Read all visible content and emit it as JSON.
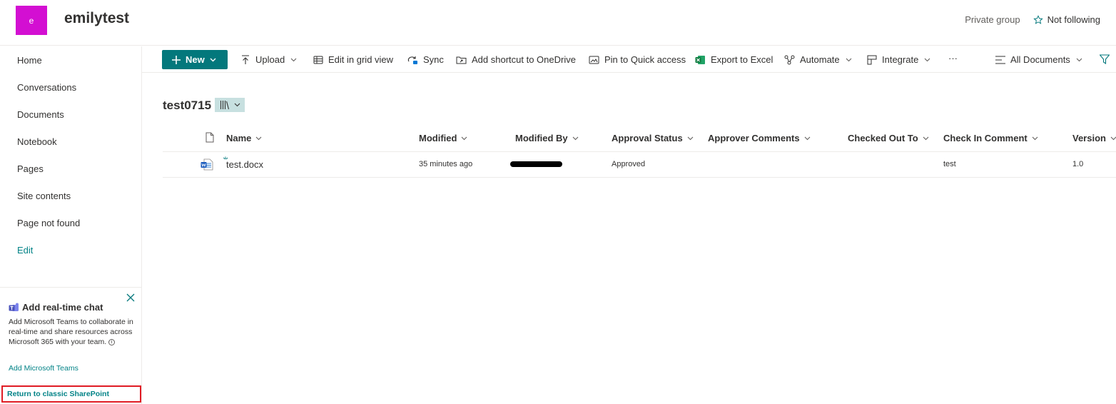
{
  "site": {
    "logo_letter": "e",
    "logo_color": "#d30fd2",
    "title": "emilytest",
    "privacy": "Private group",
    "follow_label": "Not following"
  },
  "nav": {
    "items": [
      {
        "label": "Home"
      },
      {
        "label": "Conversations"
      },
      {
        "label": "Documents"
      },
      {
        "label": "Notebook"
      },
      {
        "label": "Pages"
      },
      {
        "label": "Site contents"
      },
      {
        "label": "Page not found"
      }
    ],
    "edit_label": "Edit"
  },
  "teams_card": {
    "title": "Add real-time chat",
    "description": "Add Microsoft Teams to collaborate in real-time and share resources across Microsoft 365 with your team.",
    "link": "Add Microsoft Teams",
    "info_glyph": "i"
  },
  "classic_link": "Return to classic SharePoint",
  "command_bar": {
    "new_label": "New",
    "upload_label": "Upload",
    "grid_label": "Edit in grid view",
    "sync_label": "Sync",
    "shortcut_label": "Add shortcut to OneDrive",
    "pin_label": "Pin to Quick access",
    "export_label": "Export to Excel",
    "automate_label": "Automate",
    "integrate_label": "Integrate",
    "more_label": "···",
    "view_label": "All Documents"
  },
  "library": {
    "title": "test0715",
    "columns": {
      "name": "Name",
      "modified": "Modified",
      "modified_by": "Modified By",
      "approval_status": "Approval Status",
      "approver_comments": "Approver Comments",
      "checked_out_to": "Checked Out To",
      "check_in_comment": "Check In Comment",
      "version": "Version"
    },
    "rows": [
      {
        "name": "test.docx",
        "modified": "35 minutes ago",
        "approval_status": "Approved",
        "approver_comments": "",
        "checked_out_to": "",
        "check_in_comment": "test",
        "version": "1.0"
      }
    ]
  },
  "colors": {
    "accent": "#03787c",
    "link": "#038387",
    "highlight_box": "#e01b24"
  }
}
